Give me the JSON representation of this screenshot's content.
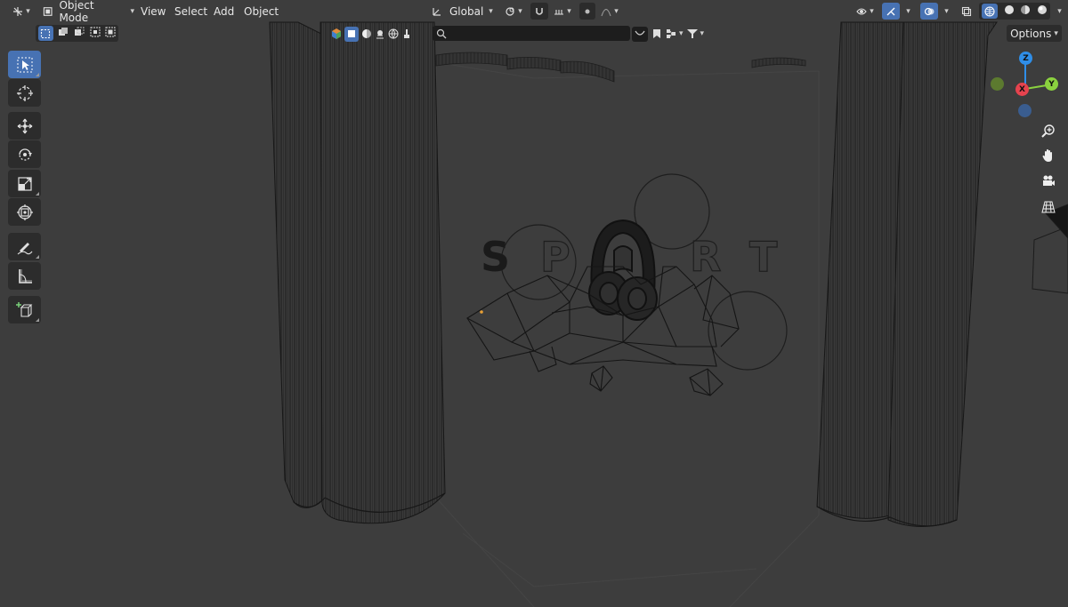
{
  "header": {
    "editor_type_icon": "3d-viewport-icon",
    "mode": {
      "label": "Object Mode",
      "icon": "object-mode-icon"
    },
    "menus": [
      "View",
      "Select",
      "Add",
      "Object"
    ],
    "transform_orientation": {
      "label": "Global",
      "icon": "orientation-axes-icon"
    },
    "pivot_icon": "pivot-point-icon",
    "snap_icon": "snap-magnet-icon",
    "snap_increment_icon": "snap-increment-icon",
    "proportional_icon": "proportional-editing-icon",
    "falloff_icon": "falloff-curve-icon",
    "right_icons": [
      "visibility-eye-icon",
      "gizmo-icon",
      "overlay-icon",
      "xray-icon",
      "wireframe-shading-icon",
      "solid-shading-icon",
      "material-shading-icon",
      "rendered-shading-icon"
    ]
  },
  "subheader": {
    "selection_modes": [
      "select-new-icon",
      "select-extend-icon",
      "select-subtract-icon",
      "select-invert-icon",
      "select-intersect-icon"
    ],
    "filter_icons": [
      "object-type-icon",
      "mesh-filter-icon",
      "material-filter-icon",
      "light-filter-icon",
      "world-filter-icon",
      "brush-filter-icon"
    ],
    "search": {
      "value": "",
      "placeholder": ""
    },
    "options_label": "Options"
  },
  "toolbar": {
    "tools": [
      {
        "name": "select-box",
        "icon": "cursor-arrow-icon",
        "active": true
      },
      {
        "name": "cursor",
        "icon": "3d-cursor-icon",
        "active": false
      },
      {
        "name": "move",
        "icon": "move-arrows-icon",
        "active": false
      },
      {
        "name": "rotate",
        "icon": "rotate-icon",
        "active": false
      },
      {
        "name": "scale",
        "icon": "scale-icon",
        "active": false
      },
      {
        "name": "transform",
        "icon": "transform-icon",
        "active": false
      },
      {
        "name": "annotate",
        "icon": "annotate-pen-icon",
        "active": false
      },
      {
        "name": "measure",
        "icon": "measure-ruler-icon",
        "active": false
      },
      {
        "name": "add-cube",
        "icon": "add-cube-icon",
        "active": false
      }
    ]
  },
  "gizmo": {
    "axes": {
      "x": "X",
      "y": "Y",
      "z": "Z"
    },
    "colors": {
      "x": "#e6434e",
      "y": "#8bd23f",
      "z": "#2f8ee8",
      "neg_y": "#5c7a2f",
      "neg_z": "#3a5d8f"
    }
  },
  "nav_icons": [
    "zoom-magnifier-icon",
    "pan-hand-icon",
    "camera-view-icon",
    "perspective-grid-icon"
  ],
  "scene": {
    "letters": [
      "S",
      "P",
      "O",
      "R",
      "T"
    ]
  },
  "colors": {
    "viewport_bg": "#3d3d3d",
    "header_bg": "#303030",
    "accent": "#4772b3",
    "wire": "#141414",
    "selection_dot": "#e8a035"
  }
}
